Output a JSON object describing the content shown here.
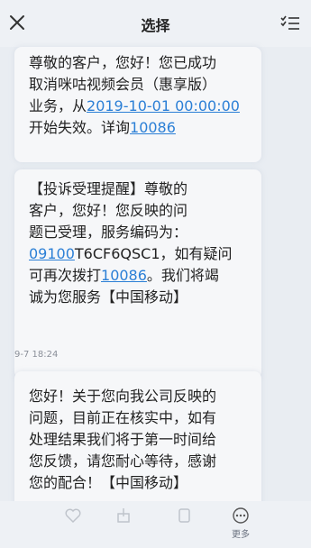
{
  "header": {
    "title": "选择"
  },
  "messages": [
    {
      "lines": [
        {
          "text": "尊敬的客户，您好！您已成功"
        },
        {
          "text": "取消咪咕视频会员（惠享版）"
        },
        {
          "pre": "业务，从",
          "link": "2019-10-01 00:00:00"
        },
        {
          "pre": "开始失效。详询",
          "link": "10086"
        }
      ]
    },
    {
      "lines": [
        {
          "text": "【投诉受理提醒】尊敬的"
        },
        {
          "text": "客户，您好！您反映的问"
        },
        {
          "text": "题已受理，服务编码为："
        },
        {
          "link": "09100",
          "post": "T6CF6QSC1，如有疑问"
        },
        {
          "pre": "可再次拨打",
          "link": "10086",
          "post": "。我们将竭"
        },
        {
          "text": "诚为您服务【中国移动】"
        }
      ]
    },
    {
      "timestamp": "9-7 18:24",
      "lines": [
        {
          "text": "您好！关于您向我公司反映的"
        },
        {
          "text": "问题，目前正在核实中，如有"
        },
        {
          "text": "处理结果我们将于第一时间给"
        },
        {
          "text": "您反馈，请您耐心等待，感谢"
        },
        {
          "text": "您的配合！【中国移动】"
        }
      ]
    }
  ],
  "toolbar": {
    "more_label": "更多"
  },
  "icons": {
    "close": "close-icon",
    "select": "checklist-icon",
    "more": "more-dots-icon"
  },
  "colors": {
    "link": "#2b7fd6"
  }
}
